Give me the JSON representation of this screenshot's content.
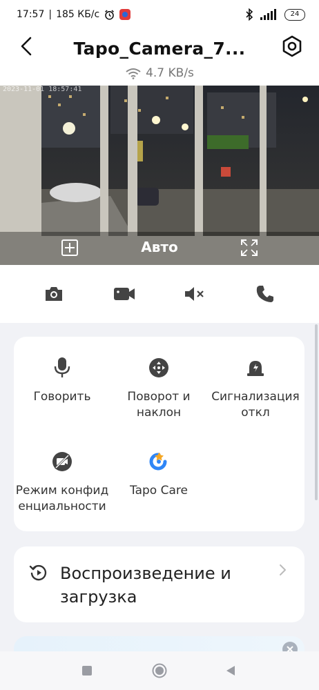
{
  "status_bar": {
    "time": "17:57",
    "separator": "|",
    "network_speed": "185 КБ/с",
    "battery": "24"
  },
  "header": {
    "title": "Tapo_Camera_7...",
    "speed": "4.7 KB/s"
  },
  "video": {
    "timestamp": "2023-11-01 18:57:41",
    "quality_label": "Авто"
  },
  "features": [
    {
      "label": "Говорить",
      "icon": "microphone-icon"
    },
    {
      "label": "Поворот и наклон",
      "icon": "pan-tilt-icon"
    },
    {
      "label": "Сигнализация откл",
      "icon": "siren-icon"
    },
    {
      "label": "Режим конфид енциальности",
      "icon": "privacy-mode-icon"
    },
    {
      "label": "Tapo Care",
      "icon": "tapo-care-icon"
    }
  ],
  "playback": {
    "label": "Воспроизведение и загрузка"
  },
  "colors": {
    "accent": "#2f86f6",
    "tapo_care_orange": "#f5a623",
    "background": "#f1f2f6"
  }
}
